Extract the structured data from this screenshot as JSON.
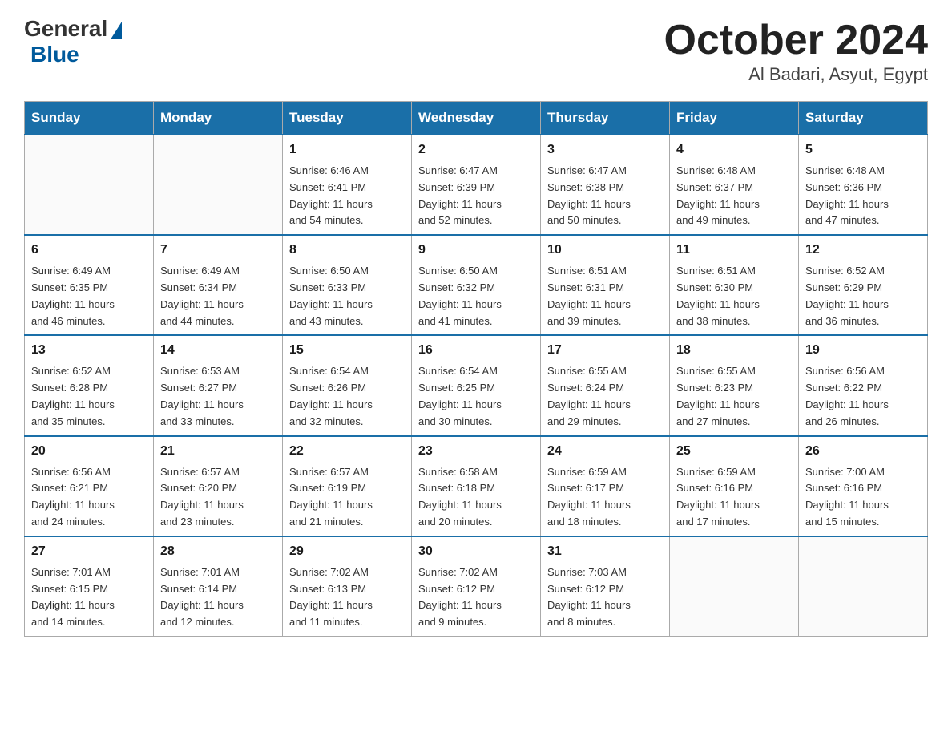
{
  "header": {
    "logo": {
      "general": "General",
      "blue": "Blue"
    },
    "title": "October 2024",
    "location": "Al Badari, Asyut, Egypt"
  },
  "days_of_week": [
    "Sunday",
    "Monday",
    "Tuesday",
    "Wednesday",
    "Thursday",
    "Friday",
    "Saturday"
  ],
  "weeks": [
    [
      {
        "day": "",
        "info": ""
      },
      {
        "day": "",
        "info": ""
      },
      {
        "day": "1",
        "info": "Sunrise: 6:46 AM\nSunset: 6:41 PM\nDaylight: 11 hours\nand 54 minutes."
      },
      {
        "day": "2",
        "info": "Sunrise: 6:47 AM\nSunset: 6:39 PM\nDaylight: 11 hours\nand 52 minutes."
      },
      {
        "day": "3",
        "info": "Sunrise: 6:47 AM\nSunset: 6:38 PM\nDaylight: 11 hours\nand 50 minutes."
      },
      {
        "day": "4",
        "info": "Sunrise: 6:48 AM\nSunset: 6:37 PM\nDaylight: 11 hours\nand 49 minutes."
      },
      {
        "day": "5",
        "info": "Sunrise: 6:48 AM\nSunset: 6:36 PM\nDaylight: 11 hours\nand 47 minutes."
      }
    ],
    [
      {
        "day": "6",
        "info": "Sunrise: 6:49 AM\nSunset: 6:35 PM\nDaylight: 11 hours\nand 46 minutes."
      },
      {
        "day": "7",
        "info": "Sunrise: 6:49 AM\nSunset: 6:34 PM\nDaylight: 11 hours\nand 44 minutes."
      },
      {
        "day": "8",
        "info": "Sunrise: 6:50 AM\nSunset: 6:33 PM\nDaylight: 11 hours\nand 43 minutes."
      },
      {
        "day": "9",
        "info": "Sunrise: 6:50 AM\nSunset: 6:32 PM\nDaylight: 11 hours\nand 41 minutes."
      },
      {
        "day": "10",
        "info": "Sunrise: 6:51 AM\nSunset: 6:31 PM\nDaylight: 11 hours\nand 39 minutes."
      },
      {
        "day": "11",
        "info": "Sunrise: 6:51 AM\nSunset: 6:30 PM\nDaylight: 11 hours\nand 38 minutes."
      },
      {
        "day": "12",
        "info": "Sunrise: 6:52 AM\nSunset: 6:29 PM\nDaylight: 11 hours\nand 36 minutes."
      }
    ],
    [
      {
        "day": "13",
        "info": "Sunrise: 6:52 AM\nSunset: 6:28 PM\nDaylight: 11 hours\nand 35 minutes."
      },
      {
        "day": "14",
        "info": "Sunrise: 6:53 AM\nSunset: 6:27 PM\nDaylight: 11 hours\nand 33 minutes."
      },
      {
        "day": "15",
        "info": "Sunrise: 6:54 AM\nSunset: 6:26 PM\nDaylight: 11 hours\nand 32 minutes."
      },
      {
        "day": "16",
        "info": "Sunrise: 6:54 AM\nSunset: 6:25 PM\nDaylight: 11 hours\nand 30 minutes."
      },
      {
        "day": "17",
        "info": "Sunrise: 6:55 AM\nSunset: 6:24 PM\nDaylight: 11 hours\nand 29 minutes."
      },
      {
        "day": "18",
        "info": "Sunrise: 6:55 AM\nSunset: 6:23 PM\nDaylight: 11 hours\nand 27 minutes."
      },
      {
        "day": "19",
        "info": "Sunrise: 6:56 AM\nSunset: 6:22 PM\nDaylight: 11 hours\nand 26 minutes."
      }
    ],
    [
      {
        "day": "20",
        "info": "Sunrise: 6:56 AM\nSunset: 6:21 PM\nDaylight: 11 hours\nand 24 minutes."
      },
      {
        "day": "21",
        "info": "Sunrise: 6:57 AM\nSunset: 6:20 PM\nDaylight: 11 hours\nand 23 minutes."
      },
      {
        "day": "22",
        "info": "Sunrise: 6:57 AM\nSunset: 6:19 PM\nDaylight: 11 hours\nand 21 minutes."
      },
      {
        "day": "23",
        "info": "Sunrise: 6:58 AM\nSunset: 6:18 PM\nDaylight: 11 hours\nand 20 minutes."
      },
      {
        "day": "24",
        "info": "Sunrise: 6:59 AM\nSunset: 6:17 PM\nDaylight: 11 hours\nand 18 minutes."
      },
      {
        "day": "25",
        "info": "Sunrise: 6:59 AM\nSunset: 6:16 PM\nDaylight: 11 hours\nand 17 minutes."
      },
      {
        "day": "26",
        "info": "Sunrise: 7:00 AM\nSunset: 6:16 PM\nDaylight: 11 hours\nand 15 minutes."
      }
    ],
    [
      {
        "day": "27",
        "info": "Sunrise: 7:01 AM\nSunset: 6:15 PM\nDaylight: 11 hours\nand 14 minutes."
      },
      {
        "day": "28",
        "info": "Sunrise: 7:01 AM\nSunset: 6:14 PM\nDaylight: 11 hours\nand 12 minutes."
      },
      {
        "day": "29",
        "info": "Sunrise: 7:02 AM\nSunset: 6:13 PM\nDaylight: 11 hours\nand 11 minutes."
      },
      {
        "day": "30",
        "info": "Sunrise: 7:02 AM\nSunset: 6:12 PM\nDaylight: 11 hours\nand 9 minutes."
      },
      {
        "day": "31",
        "info": "Sunrise: 7:03 AM\nSunset: 6:12 PM\nDaylight: 11 hours\nand 8 minutes."
      },
      {
        "day": "",
        "info": ""
      },
      {
        "day": "",
        "info": ""
      }
    ]
  ]
}
